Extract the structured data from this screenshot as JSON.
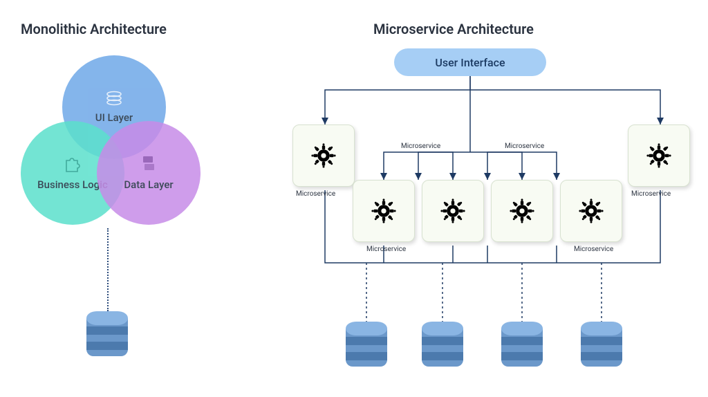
{
  "monolithic": {
    "title": "Monolithic Architecture",
    "layers": {
      "ui": "UI Layer",
      "business": "Business Logic",
      "data": "Data Layer"
    }
  },
  "microservice": {
    "title": "Microservice Architecture",
    "ui_box": "User Interface",
    "service_label": "Microservice",
    "colors": {
      "ui_box_bg": "#a6cef5",
      "gear": "#3a7bd5",
      "line": "#1e3a63"
    },
    "services": [
      {
        "id": "ms-left",
        "row": 1
      },
      {
        "id": "ms-right",
        "row": 1
      },
      {
        "id": "ms-b1",
        "row": 2
      },
      {
        "id": "ms-b2",
        "row": 2
      },
      {
        "id": "ms-b3",
        "row": 2
      },
      {
        "id": "ms-b4",
        "row": 2
      }
    ],
    "databases": 4
  }
}
